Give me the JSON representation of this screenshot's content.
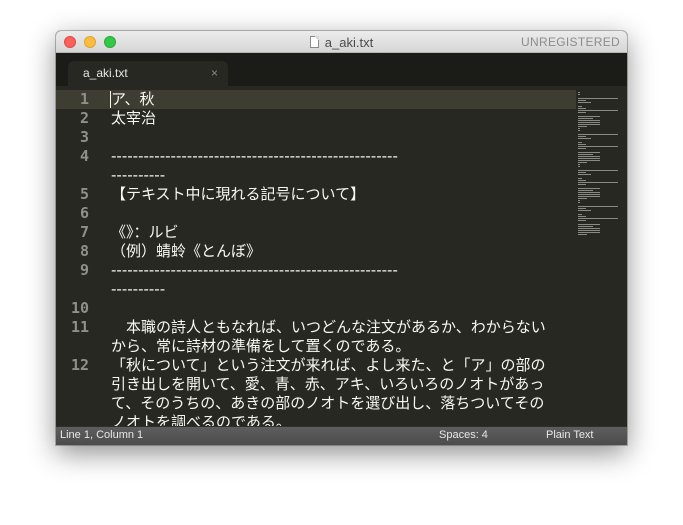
{
  "window": {
    "title": "a_aki.txt",
    "license_notice": "UNREGISTERED"
  },
  "tabs": [
    {
      "label": "a_aki.txt",
      "close_glyph": "×",
      "active": true
    }
  ],
  "editor": {
    "line_numbers": [
      "1",
      "2",
      "3",
      "4",
      "",
      "5",
      "6",
      "7",
      "8",
      "9",
      "",
      "10",
      "11",
      "",
      "12",
      "",
      "",
      ""
    ],
    "lines": [
      "ア、秋",
      "太宰治",
      "",
      "-----------------------------------------------------",
      "----------",
      "【テキスト中に現れる記号について】",
      "",
      "《》：ルビ",
      "（例）蜻蛉《とんぼ》",
      "-----------------------------------------------------",
      "----------",
      "",
      "　本職の詩人ともなれば、いつどんな注文があるか、わからない",
      "から、常に詩材の準備をして置くのである。",
      "「秋について」という注文が来れば、よし来た、と「ア」の部の",
      "引き出しを開いて、愛、青、赤、アキ、いろいろのノオトがあっ",
      "て、そのうちの、あきの部のノオトを選び出し、落ちついてその",
      "ノオトを調べるのである。"
    ]
  },
  "status_bar": {
    "position": "Line 1, Column 1",
    "indentation": "Spaces: 4",
    "syntax": "Plain Text"
  },
  "colors": {
    "editor_bg": "#272822",
    "text": "#f8f8f2",
    "gutter_text": "#8f908a",
    "close_light": "#fc605c",
    "minimize_light": "#fdbc40",
    "maximize_light": "#34c84a"
  }
}
